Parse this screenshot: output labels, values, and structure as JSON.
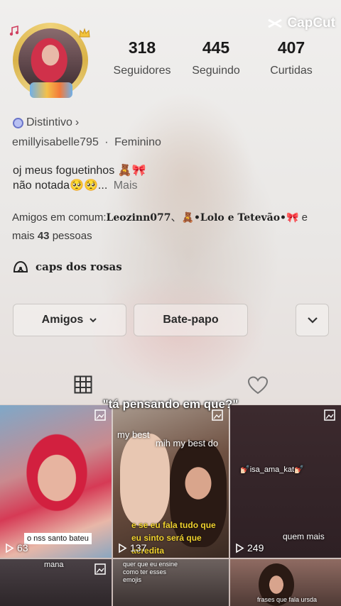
{
  "watermark": {
    "brand": "CapCut"
  },
  "profile": {
    "stats": [
      {
        "value": "318",
        "label": "Seguidores"
      },
      {
        "value": "445",
        "label": "Seguindo"
      },
      {
        "value": "407",
        "label": "Curtidas"
      }
    ],
    "badge_label": "Distintivo",
    "badge_chevron": "›",
    "username": "emillyisabelle795",
    "separator": "·",
    "gender": "Feminino",
    "bio_line1": "oj meus foguetinhos 🧸🎀",
    "bio_line2": "não notada🥺🥺...",
    "bio_more": "Mais",
    "friends_prefix": "Amigos em comum:",
    "friend1": "Leozinn077",
    "friend_sep": "、",
    "friend2": "🧸•Lolo e Tetevão•🎀",
    "friends_and": "e",
    "friends_more_prefix": "mais",
    "friends_count": "43",
    "friends_suffix": "pessoas",
    "group_name": "caps dos rosas"
  },
  "actions": {
    "friends_button": "Amigos",
    "chat_button": "Bate-papo"
  },
  "tabs": {
    "videos_icon": "grid-icon",
    "liked_icon": "heart-icon"
  },
  "caption": "\"tá pensando em que?\"",
  "videos": [
    {
      "views": "63",
      "overlay": "o nss santo bateu"
    },
    {
      "views": "137",
      "overlay_top": "my best",
      "overlay_top2": "mih my best do",
      "overlay_bottom": "e se eu fala tudo que eu sinto será que acredita"
    },
    {
      "views": "249",
      "overlay_top": "💅🏻isa_ama_kat💅🏻",
      "overlay_bottom": "quem mais"
    },
    {
      "overlay": "mana"
    },
    {
      "overlay": "quer que eu ensine como ter esses emojis"
    },
    {
      "overlay": "frases que fala ursda"
    }
  ]
}
